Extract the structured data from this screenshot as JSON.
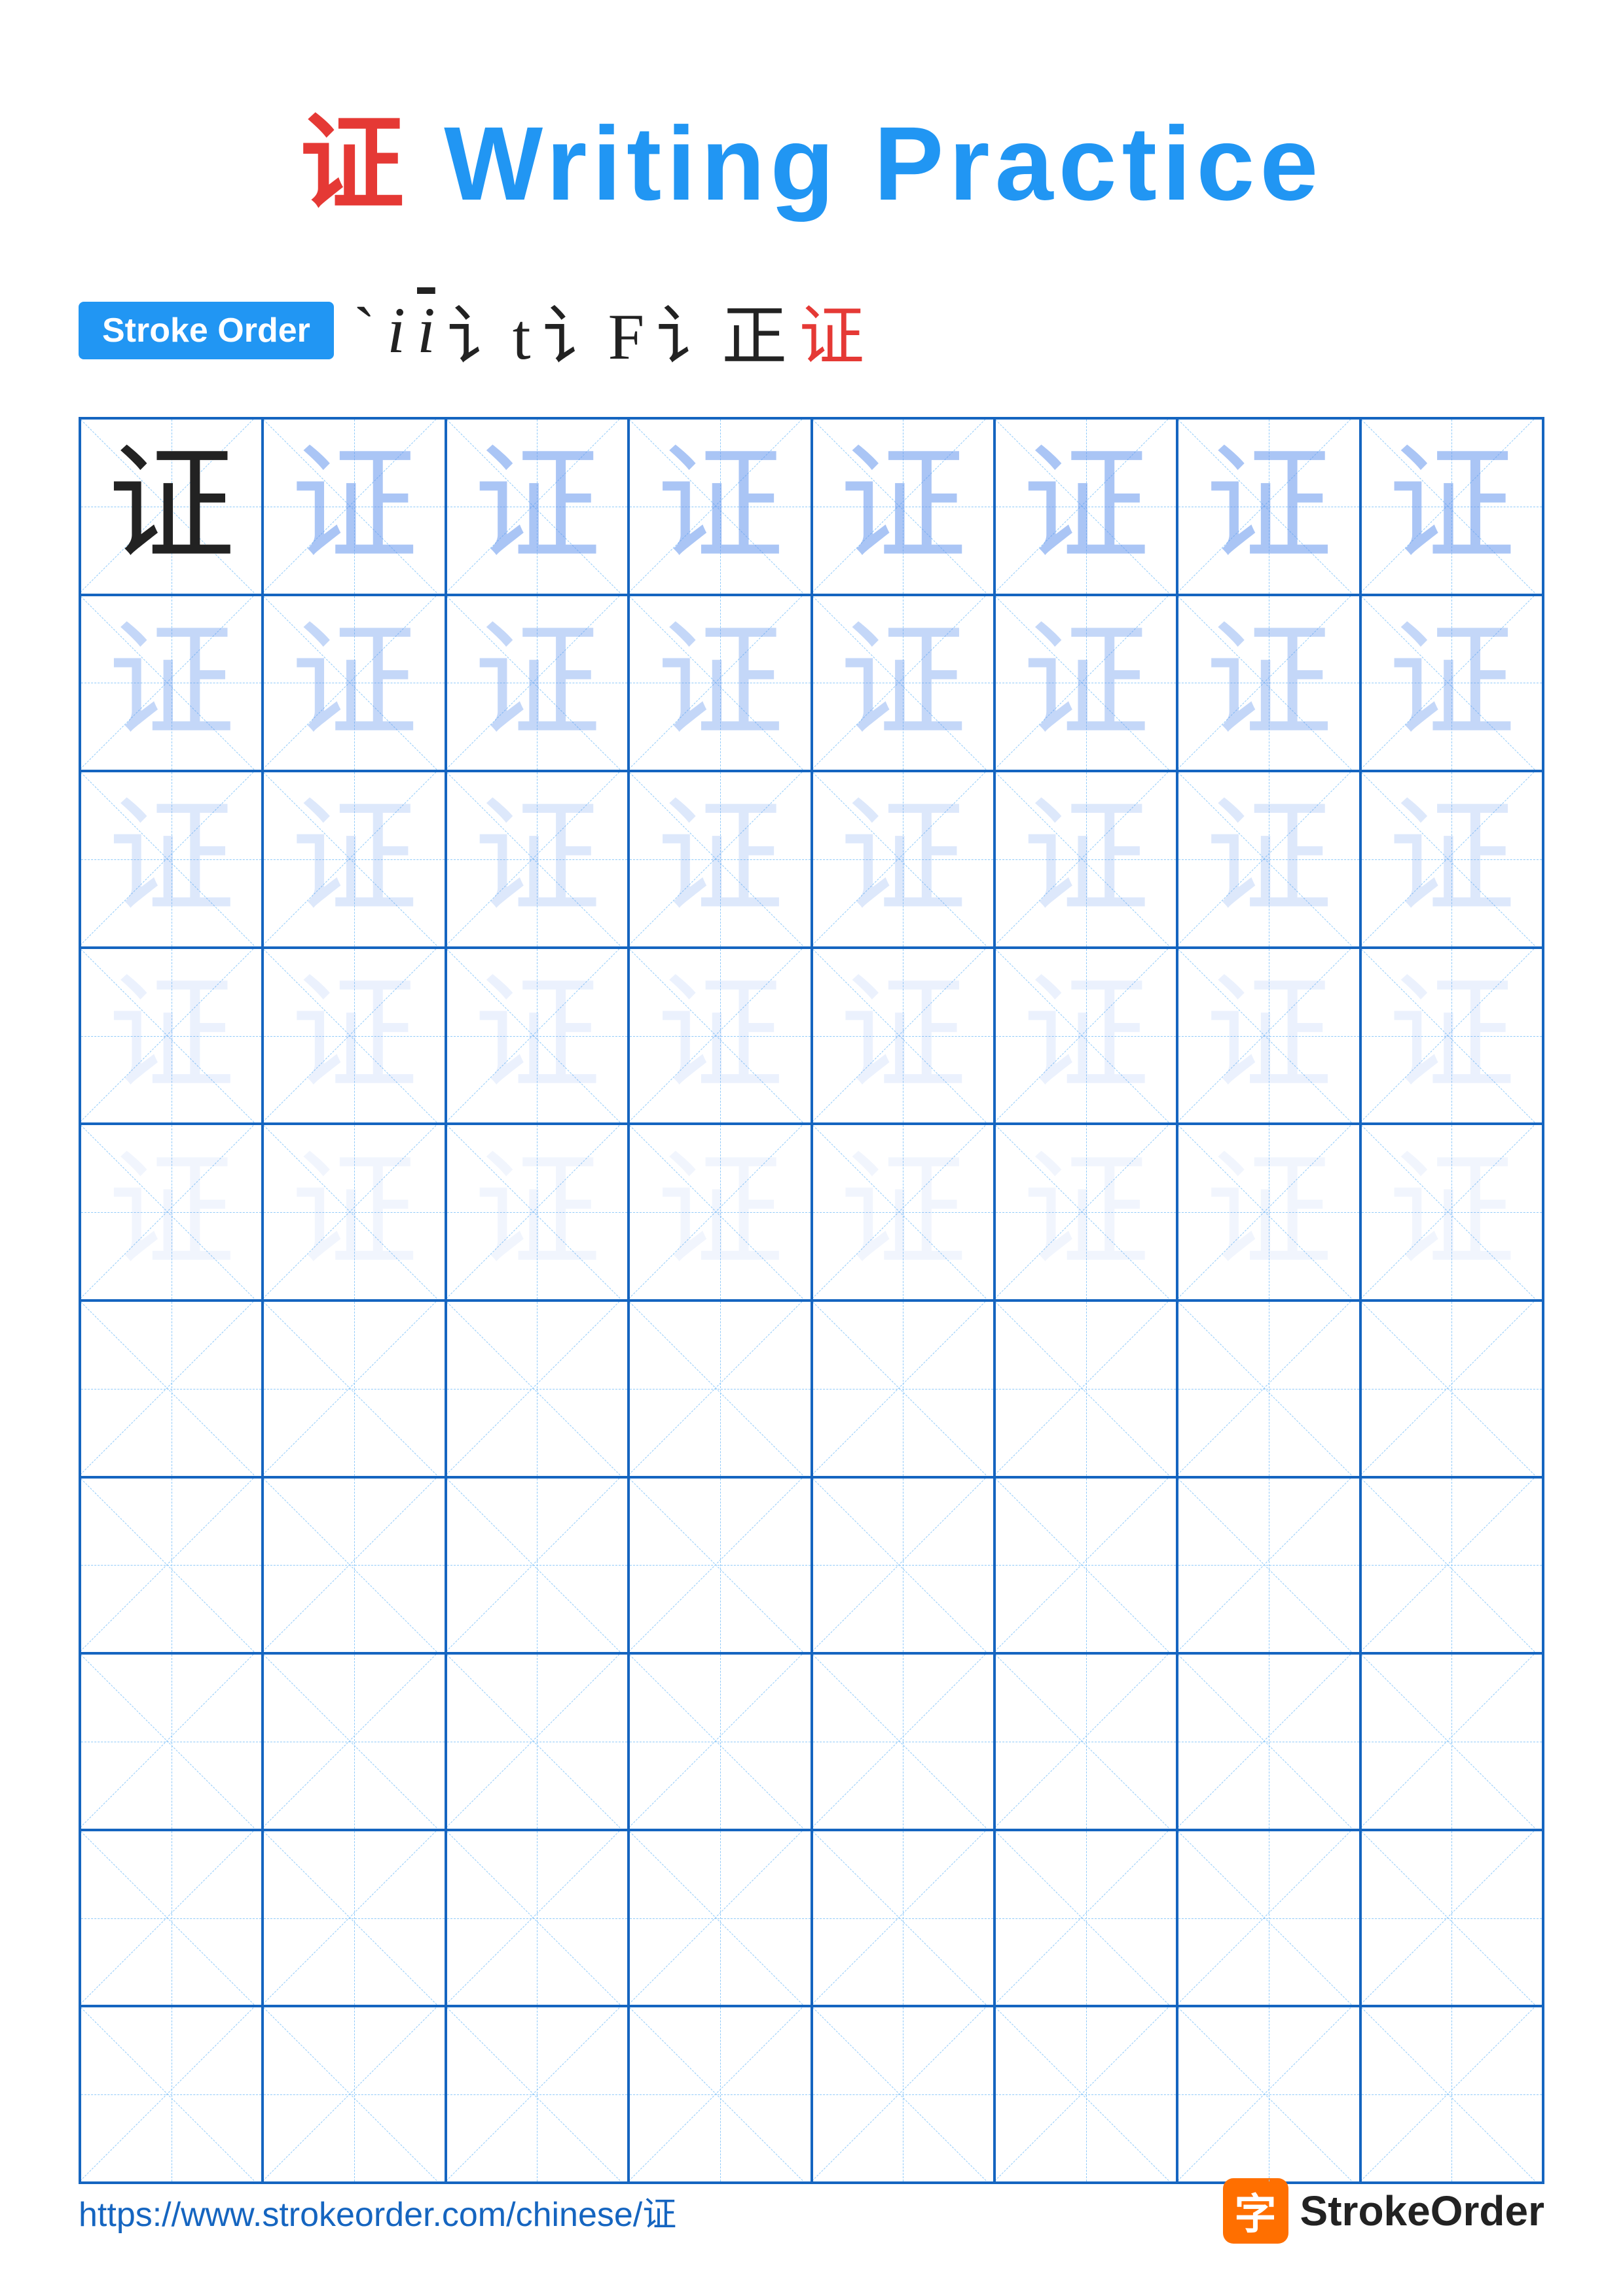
{
  "title": {
    "chinese": "证",
    "english": " Writing Practice"
  },
  "stroke_order": {
    "badge_label": "Stroke Order",
    "sequence": [
      "` ",
      "i",
      "i⁻",
      "讠t",
      "讠F",
      "讠正",
      "证"
    ]
  },
  "grid": {
    "rows": 10,
    "cols": 8,
    "character": "证",
    "filled_rows": 5,
    "opacity_levels": [
      "solid",
      "light1",
      "light2",
      "light3",
      "light4"
    ]
  },
  "footer": {
    "url": "https://www.strokeorder.com/chinese/证",
    "logo_char": "字",
    "logo_text": "StrokeOrder"
  }
}
